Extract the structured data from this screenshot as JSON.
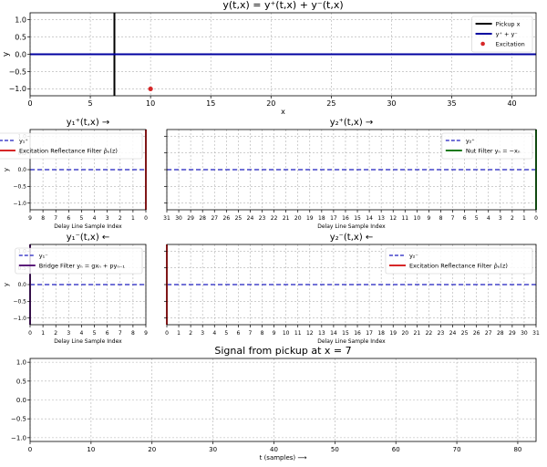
{
  "colors": {
    "axis": "#000000",
    "grid": "#b0b0b0",
    "dash_blue": "#1f1fbf",
    "solid_blue": "#0000a0",
    "red": "#d62728",
    "green": "#1a7a1a",
    "purple": "#5b1a7a",
    "black": "#000000"
  },
  "chart_data": [
    {
      "id": "string",
      "type": "line",
      "title": "y(t,x) = y⁺(t,x) + y⁻(t,x)",
      "xlabel": "x",
      "ylabel": "y",
      "xlim": [
        0,
        42
      ],
      "ylim": [
        -1.2,
        1.2
      ],
      "xticks": [
        0,
        5,
        10,
        15,
        20,
        25,
        30,
        35,
        40
      ],
      "yticks": [
        -1.0,
        -0.5,
        0.0,
        0.5,
        1.0
      ],
      "ytick_labels": [
        "−1.0",
        "−0.5",
        "0.0",
        "0.5",
        "1.0"
      ],
      "grid": true,
      "legend_placement": "top-right",
      "series": [
        {
          "name": "Pickup x",
          "kind": "vline",
          "x": 7,
          "color": "black"
        },
        {
          "name": "y⁺ + y⁻",
          "kind": "line",
          "x": [
            0,
            42
          ],
          "y": [
            0,
            0
          ],
          "color": "solid_blue"
        },
        {
          "name": "Excitation",
          "kind": "point",
          "x": 10,
          "y": -1.0,
          "color": "red"
        }
      ]
    },
    {
      "id": "y1p",
      "type": "line",
      "title": "y₁⁺(t,x) →",
      "xlabel": "Delay Line Sample Index",
      "ylabel": "y",
      "xlim": [
        9,
        0
      ],
      "ylim": [
        -1.2,
        1.2
      ],
      "xticks": [
        9,
        8,
        7,
        6,
        5,
        4,
        3,
        2,
        1,
        0
      ],
      "yticks": [
        -1.0,
        -0.5,
        0.0,
        0.5,
        1.0
      ],
      "ytick_labels": [
        "−1.0",
        "−0.5",
        "0.0",
        "0.5",
        "1.0"
      ],
      "grid": true,
      "legend_placement": "top-right",
      "series": [
        {
          "name": "y₁⁺",
          "kind": "dashed",
          "x": [
            9,
            0
          ],
          "y": [
            0,
            0
          ],
          "color": "dash_blue"
        },
        {
          "name": "Excitation Reflectance Filter ρ̂ₑ(z)",
          "kind": "vline",
          "x": 0,
          "color": "red"
        }
      ]
    },
    {
      "id": "y2p",
      "type": "line",
      "title": "y₂⁺(t,x) →",
      "xlabel": "Delay Line Sample Index",
      "ylabel": "",
      "xlim": [
        31,
        0
      ],
      "ylim": [
        -1.2,
        1.2
      ],
      "xticks": [
        31,
        30,
        29,
        28,
        27,
        26,
        25,
        24,
        23,
        22,
        21,
        20,
        19,
        18,
        17,
        16,
        15,
        14,
        13,
        12,
        11,
        10,
        9,
        8,
        7,
        6,
        5,
        4,
        3,
        2,
        1,
        0
      ],
      "yticks": [
        -1.0,
        -0.5,
        0.0,
        0.5,
        1.0
      ],
      "grid": true,
      "legend_placement": "top-right",
      "series": [
        {
          "name": "y₂⁺",
          "kind": "dashed",
          "x": [
            31,
            0
          ],
          "y": [
            0,
            0
          ],
          "color": "dash_blue"
        },
        {
          "name": "Nut Filter yₙ = −xₙ",
          "kind": "vline",
          "x": 0,
          "color": "green"
        }
      ]
    },
    {
      "id": "y1m",
      "type": "line",
      "title": "y₁⁻(t,x) ←",
      "xlabel": "Delay Line Sample Index",
      "ylabel": "y",
      "xlim": [
        0,
        9
      ],
      "ylim": [
        -1.2,
        1.2
      ],
      "xticks": [
        0,
        1,
        2,
        3,
        4,
        5,
        6,
        7,
        8,
        9
      ],
      "yticks": [
        -1.0,
        -0.5,
        0.0,
        0.5,
        1.0
      ],
      "ytick_labels": [
        "−1.0",
        "−0.5",
        "0.0",
        "0.5",
        "1.0"
      ],
      "grid": true,
      "legend_placement": "top-right",
      "series": [
        {
          "name": "y₁⁻",
          "kind": "dashed",
          "x": [
            0,
            9
          ],
          "y": [
            0,
            0
          ],
          "color": "dash_blue"
        },
        {
          "name": "Bridge Filter yₙ = gxₙ + pyₙ₋₁",
          "kind": "vline",
          "x": 0,
          "color": "purple"
        }
      ]
    },
    {
      "id": "y2m",
      "type": "line",
      "title": "y₂⁻(t,x) ←",
      "xlabel": "Delay Line Sample Index",
      "ylabel": "",
      "xlim": [
        0,
        31
      ],
      "ylim": [
        -1.2,
        1.2
      ],
      "xticks": [
        0,
        1,
        2,
        3,
        4,
        5,
        6,
        7,
        8,
        9,
        10,
        11,
        12,
        13,
        14,
        15,
        16,
        17,
        18,
        19,
        20,
        21,
        22,
        23,
        24,
        25,
        26,
        27,
        28,
        29,
        30,
        31
      ],
      "yticks": [
        -1.0,
        -0.5,
        0.0,
        0.5,
        1.0
      ],
      "grid": true,
      "legend_placement": "top-right",
      "series": [
        {
          "name": "y₂⁻",
          "kind": "dashed",
          "x": [
            0,
            31
          ],
          "y": [
            0,
            0
          ],
          "color": "dash_blue"
        },
        {
          "name": "Excitation Reflectance Filter ρ̂ₑ(z)",
          "kind": "vline",
          "x": 0,
          "color": "red"
        }
      ]
    },
    {
      "id": "pickup",
      "type": "line",
      "title": "Signal from pickup at x = 7",
      "xlabel": "t (samples) ⟶",
      "ylabel": "",
      "xlim": [
        0,
        83
      ],
      "ylim": [
        -1.1,
        1.1
      ],
      "xticks": [
        0,
        10,
        20,
        30,
        40,
        50,
        60,
        70,
        80
      ],
      "yticks": [
        -1.0,
        -0.5,
        0.0,
        0.5,
        1.0
      ],
      "ytick_labels": [
        "−1.0",
        "−0.5",
        "0.0",
        "0.5",
        "1.0"
      ],
      "grid": true,
      "legend_placement": "",
      "series": []
    }
  ]
}
